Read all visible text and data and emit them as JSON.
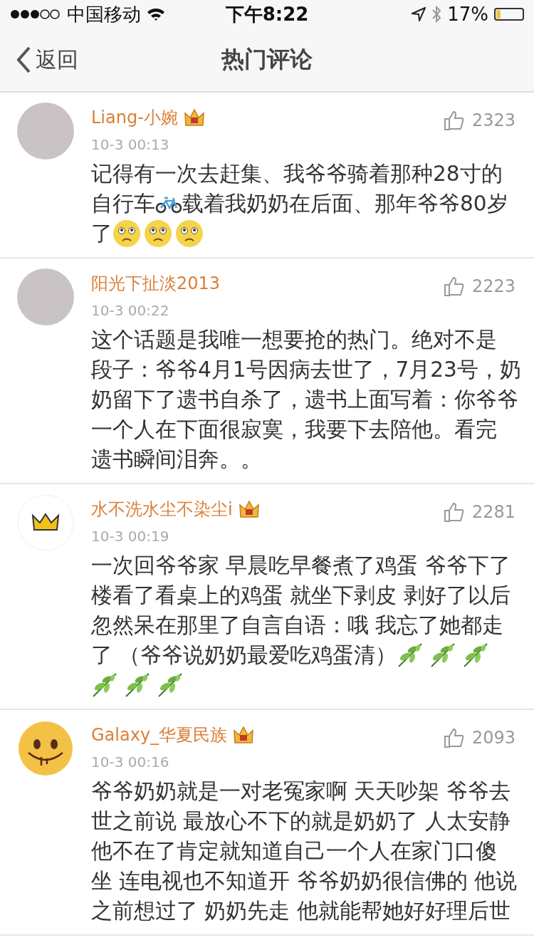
{
  "status_bar": {
    "carrier": "中国移动",
    "time": "下午8:22",
    "battery": "17%"
  },
  "nav": {
    "back": "返回",
    "title": "热门评论"
  },
  "comments": [
    {
      "avatar": {
        "kind": "photo"
      },
      "user": "Liang-小婉",
      "badge": true,
      "time": "10-3 00:13",
      "likes": "2323",
      "lines": [
        [
          {
            "kind": "text",
            "text": "记得有一次去赶集、我爷爷骑着那种28寸的"
          }
        ],
        [
          {
            "kind": "text",
            "text": "自行车"
          },
          {
            "kind": "bicycle"
          },
          {
            "kind": "text",
            "text": "载着我奶奶在后面、那年爷爷80岁"
          }
        ],
        [
          {
            "kind": "text",
            "text": "了"
          },
          {
            "kind": "sad"
          },
          {
            "kind": "sad"
          },
          {
            "kind": "sad"
          }
        ]
      ]
    },
    {
      "avatar": {
        "kind": "photo"
      },
      "user": "阳光下扯淡2013",
      "badge": false,
      "time": "10-3 00:22",
      "likes": "2223",
      "lines": [
        [
          {
            "kind": "text",
            "text": "这个话题是我唯一想要抢的热门。绝对不是"
          }
        ],
        [
          {
            "kind": "text",
            "text": "段子：爷爷4月1号因病去世了，7月23号，奶"
          }
        ],
        [
          {
            "kind": "text",
            "text": "奶留下了遗书自杀了，遗书上面写着：你爷爷"
          }
        ],
        [
          {
            "kind": "text",
            "text": "一个人在下面很寂寞，我要下去陪他。看完"
          }
        ],
        [
          {
            "kind": "text",
            "text": "遗书瞬间泪奔。。"
          }
        ]
      ]
    },
    {
      "avatar": {
        "kind": "crown"
      },
      "user": "水不洗水尘不染尘i",
      "badge": true,
      "time": "10-3 00:19",
      "likes": "2281",
      "lines": [
        [
          {
            "kind": "text",
            "text": "一次回爷爷家 早晨吃早餐煮了鸡蛋 爷爷下了"
          }
        ],
        [
          {
            "kind": "text",
            "text": "楼看了看桌上的鸡蛋 就坐下剥皮 剥好了以后"
          }
        ],
        [
          {
            "kind": "text",
            "text": "忽然呆在那里了自言自语：哦 我忘了她都走"
          }
        ],
        [
          {
            "kind": "text",
            "text": "了 （爷爷说奶奶最爱吃鸡蛋清）"
          },
          {
            "kind": "leaf"
          },
          {
            "kind": "leaf"
          },
          {
            "kind": "leaf"
          }
        ],
        [
          {
            "kind": "leaf"
          },
          {
            "kind": "leaf"
          },
          {
            "kind": "leaf"
          }
        ]
      ]
    },
    {
      "avatar": {
        "kind": "smiley"
      },
      "user": "Galaxy_华夏民族",
      "badge": true,
      "time": "10-3 00:16",
      "likes": "2093",
      "lines": [
        [
          {
            "kind": "text",
            "text": "爷爷奶奶就是一对老冤家啊 天天吵架 爷爷去"
          }
        ],
        [
          {
            "kind": "text",
            "text": "世之前说 最放心不下的就是奶奶了 人太安静"
          }
        ],
        [
          {
            "kind": "text",
            "text": "他不在了肯定就知道自己一个人在家门口傻"
          }
        ],
        [
          {
            "kind": "text",
            "text": "坐 连电视也不知道开 爷爷奶奶很信佛的 他说"
          }
        ],
        [
          {
            "kind": "text",
            "text": "之前想过了 奶奶先走 他就能帮她好好理后世"
          }
        ]
      ]
    }
  ]
}
